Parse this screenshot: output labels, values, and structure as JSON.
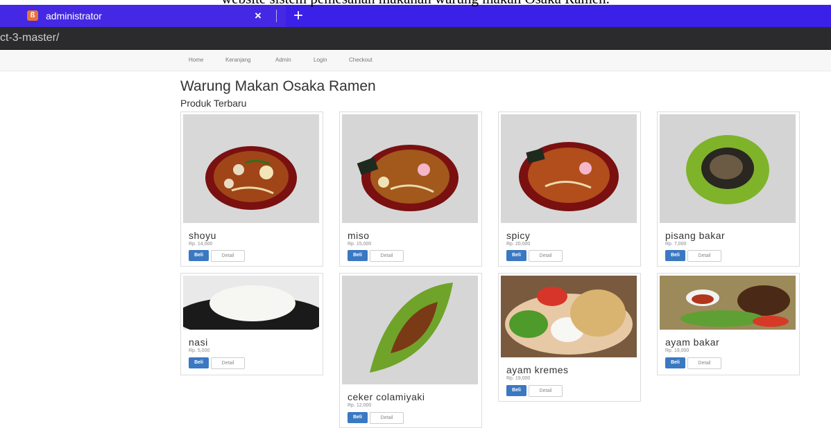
{
  "caption": "website sistem pemesanan makanan warung makan Osaka Ramen.",
  "browser": {
    "tab_title": "administrator",
    "tab_close": "×",
    "new_tab": "+",
    "url": "ct-3-master/",
    "accent": "#3b21e8"
  },
  "nav": {
    "items": [
      "Home",
      "Keranjang",
      "Admin",
      "Login",
      "Checkout"
    ]
  },
  "page": {
    "title": "Warung Makan Osaka Ramen",
    "subtitle": "Produk Terbaru"
  },
  "buttons": {
    "buy": "Beli",
    "detail": "Detail"
  },
  "products": [
    {
      "name": "shoyu",
      "price": "Rp. 14,000"
    },
    {
      "name": "miso",
      "price": "Rp. 15,000"
    },
    {
      "name": "spicy",
      "price": "Rp. 20,000"
    },
    {
      "name": "pisang bakar",
      "price": "Rp. 7,000"
    },
    {
      "name": "nasi",
      "price": "Rp. 5,000"
    },
    {
      "name": "ceker colamiyaki",
      "price": "Rp. 12,000"
    },
    {
      "name": "ayam kremes",
      "price": "Rp. 19,000"
    },
    {
      "name": "ayam bakar",
      "price": "Rp. 19,000"
    }
  ]
}
